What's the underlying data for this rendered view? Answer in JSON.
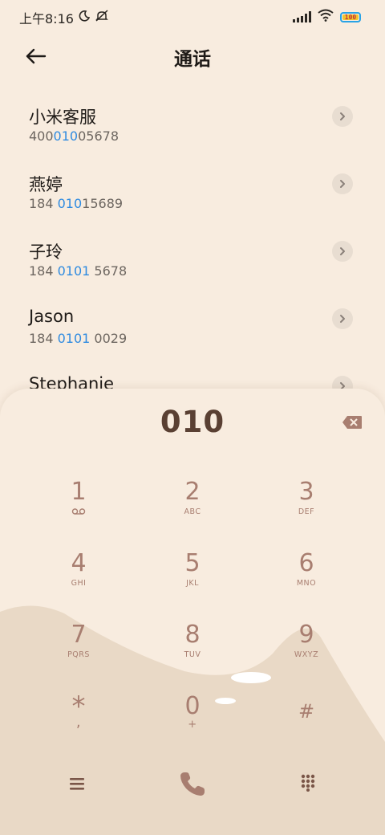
{
  "status_bar": {
    "time": "上午8:16",
    "battery": "100",
    "icons": [
      "moon-icon",
      "mute-icon",
      "signal-icon",
      "wifi-icon",
      "battery-icon"
    ]
  },
  "header": {
    "title": "通话",
    "back_icon": "arrow-left-icon"
  },
  "contacts": [
    {
      "name": "小米客服",
      "number_pre": "400",
      "number_hl": "010",
      "number_post": "05678"
    },
    {
      "name": "燕婷",
      "number_pre": "184 ",
      "number_hl": "010",
      "number_post": "15689"
    },
    {
      "name": "子玲",
      "number_pre": "184 ",
      "number_hl": "0101",
      "number_post": " 5678"
    },
    {
      "name": "Jason",
      "number_pre": "184 ",
      "number_hl": "0101",
      "number_post": " 0029"
    },
    {
      "name": "Stephanie",
      "number_pre": "",
      "number_hl": "",
      "number_post": ""
    }
  ],
  "dialer": {
    "number": "010",
    "keys": [
      {
        "digit": "1",
        "letters": ""
      },
      {
        "digit": "2",
        "letters": "ABC"
      },
      {
        "digit": "3",
        "letters": "DEF"
      },
      {
        "digit": "4",
        "letters": "GHI"
      },
      {
        "digit": "5",
        "letters": "JKL"
      },
      {
        "digit": "6",
        "letters": "MNO"
      },
      {
        "digit": "7",
        "letters": "PQRS"
      },
      {
        "digit": "8",
        "letters": "TUV"
      },
      {
        "digit": "9",
        "letters": "WXYZ"
      },
      {
        "digit": "*",
        "letters": ","
      },
      {
        "digit": "0",
        "letters": "+"
      },
      {
        "digit": "#",
        "letters": ""
      }
    ]
  },
  "colors": {
    "background": "#f8ecdf",
    "accent_blue": "#2f8be0",
    "key_text": "#a87e70",
    "dialed_text": "#5a4033",
    "hill": "#e9d9c6"
  }
}
